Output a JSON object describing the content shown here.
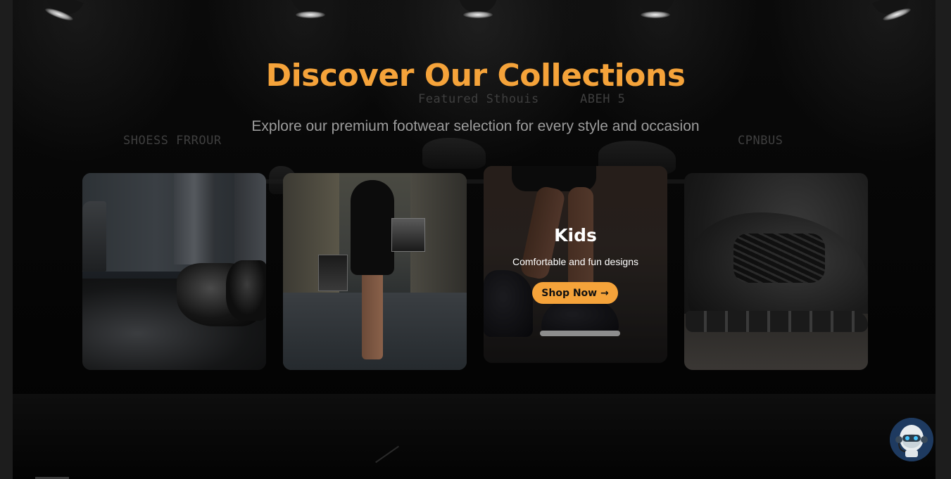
{
  "hero": {
    "title": "Discover Our Collections",
    "subtitle": "Explore our premium footwear selection for every style and occasion"
  },
  "backdrop": {
    "sign_left": "SHOESS FRROUR",
    "sign_center": "Featured Sthouis",
    "sign_center_right": "ABEH  5",
    "sign_right": "CPNBUS"
  },
  "collections": [
    {
      "image": "formal-black-leather-shoes"
    },
    {
      "image": "woman-carrying-shoe-boxes"
    },
    {
      "image": "kids-sparkly-high-top-sneakers",
      "title": "Kids",
      "description": "Comfortable and fun designs",
      "button_label": "Shop Now →"
    },
    {
      "image": "black-knit-sneaker"
    }
  ],
  "chat_widget": {
    "icon": "robot-avatar-icon"
  },
  "colors": {
    "accent": "#f5a33a",
    "background": "#050505",
    "subtitle": "#9c9c9c",
    "chat_bg": "#1e3a60"
  }
}
